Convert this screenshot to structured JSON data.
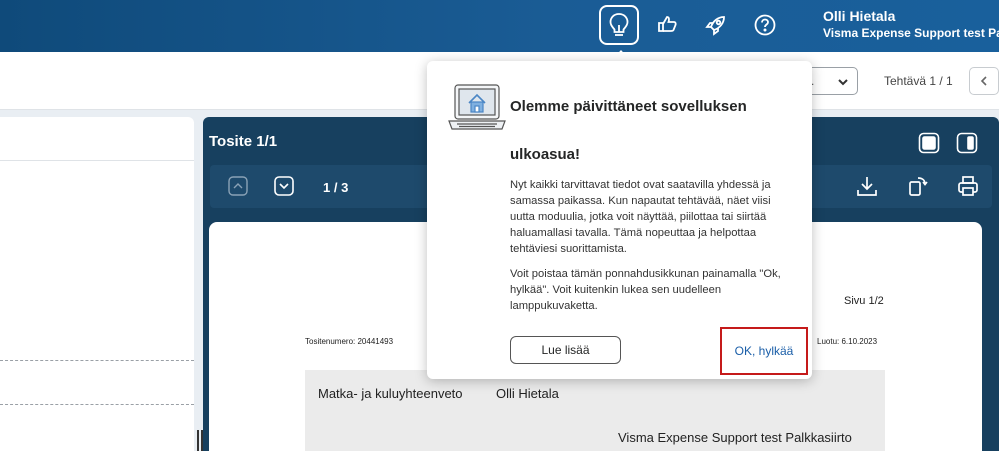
{
  "header": {
    "icons": [
      "lightbulb-icon",
      "thumbs-icon",
      "rocket-icon",
      "help-icon"
    ],
    "user_name": "Olli Hietala",
    "user_company": "Visma Expense Support test Pa"
  },
  "toolbar": {
    "select_value": ".",
    "task_counter": "Tehtävä 1 / 1"
  },
  "viewer": {
    "title": "Tosite 1/1",
    "page_indicator": "1 / 3",
    "document": {
      "page_label": "Sivu 1/2",
      "voucher_number": "Tositenumero: 20441493",
      "created": "Luotu: 6.10.2023",
      "heading": "Matka- ja kuluyhteenveto",
      "name": "Olli Hietala",
      "company": "Visma Expense Support test Palkkasiirto"
    }
  },
  "popup": {
    "title": "Olemme päivittäneet sovelluksen ulkoasua!",
    "body1": "Nyt kaikki tarvittavat tiedot ovat saatavilla yhdessä ja samassa paikassa. Kun napautat tehtävää, näet viisi uutta moduulia, jotka voit näyttää, piilottaa tai siirtää haluamallasi tavalla. Tämä nopeuttaa ja helpottaa tehtäviesi suorittamista.",
    "body2": "Voit poistaa tämän ponnahdusikkunan painamalla \"Ok, hylkää\". Voit kuitenkin lukea sen uudelleen lamppukuvaketta.",
    "read_more_label": "Lue lisää",
    "dismiss_label": "OK, hylkää"
  },
  "colors": {
    "header_bg": "#1a5c95",
    "viewer_bg": "#17405f",
    "highlight": "#c51a1a",
    "link": "#1a5ea8"
  }
}
